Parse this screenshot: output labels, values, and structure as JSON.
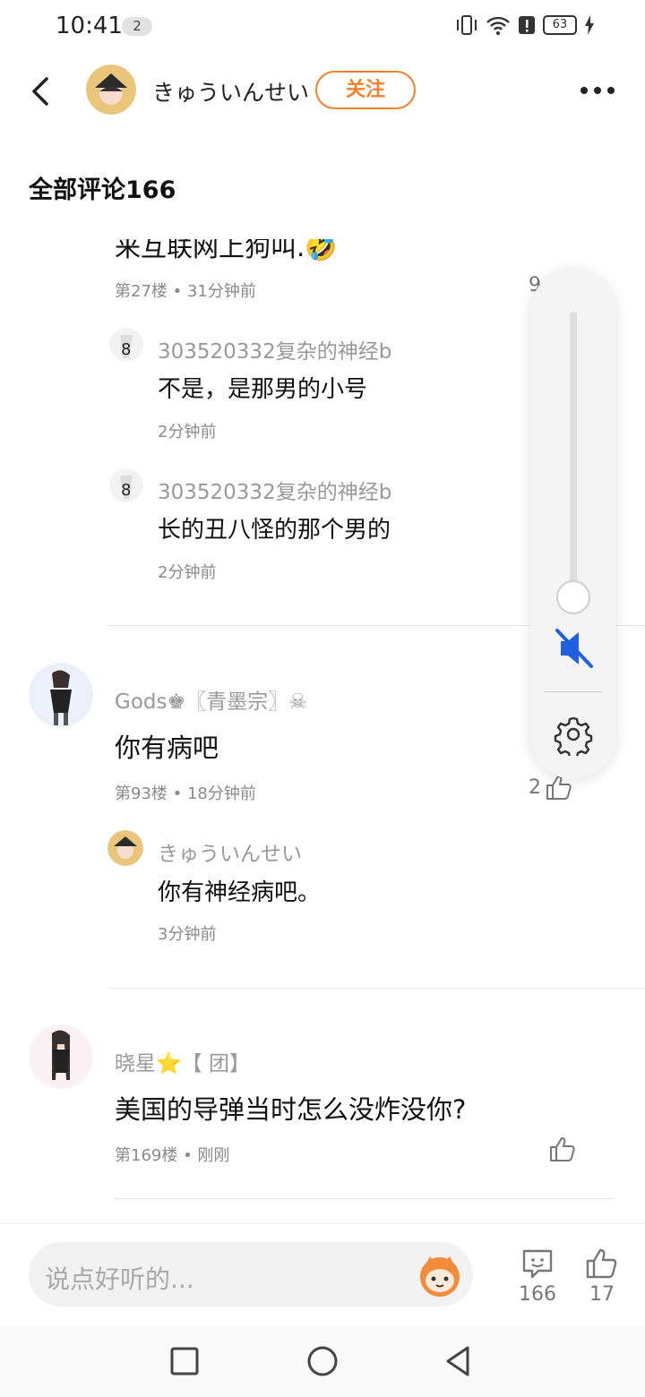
{
  "status_bar": {
    "time": "10:41",
    "notif_count": "2",
    "battery": "63"
  },
  "header": {
    "username": "きゅういんせい",
    "follow_label": "关注"
  },
  "section_title": "全部评论166",
  "comments": [
    {
      "text_clipped": "来互联网上狗叫.🤣",
      "meta": "第27楼 • 31分钟前",
      "likes": "9",
      "replies": [
        {
          "name": "303520332复杂的神经b",
          "text": "不是，是那男的小号",
          "time": "2分钟前"
        },
        {
          "name": "303520332复杂的神经b",
          "text": "长的丑八怪的那个男的",
          "time": "2分钟前"
        }
      ]
    },
    {
      "name": "Gods♚〖青墨宗〗☠",
      "text": "你有病吧",
      "meta": "第93楼 • 18分钟前",
      "likes": "2",
      "replies": [
        {
          "name": "きゅういんせい",
          "text": "你有神经病吧。",
          "time": "3分钟前"
        }
      ]
    },
    {
      "name": "晓星⭐【 团】",
      "text": "美国的导弹当时怎么没炸没你?",
      "meta": "第169楼 • 刚刚",
      "likes": ""
    }
  ],
  "volume_panel": {
    "level": 0.0,
    "muted": true
  },
  "bottom_bar": {
    "input_placeholder": "说点好听的...",
    "comment_count": "166",
    "like_count": "17"
  },
  "icons": [
    "back-icon",
    "more-icon",
    "like-icon",
    "mute-icon",
    "settings-gear-icon",
    "comment-icon",
    "square-nav-icon",
    "circle-nav-icon",
    "triangle-nav-icon"
  ],
  "colors": {
    "accent": "#f0822a",
    "mute_blue": "#1f5fe0"
  }
}
